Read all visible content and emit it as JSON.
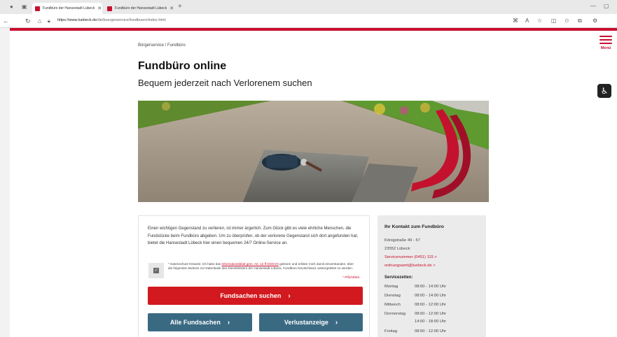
{
  "browser": {
    "tabs": [
      {
        "title": "Fundbüro der Hansestadt Lübeck",
        "active": true
      },
      {
        "title": "Fundbüro der Hansestadt Lübeck",
        "active": false
      }
    ],
    "new_tab": "+",
    "url_host": "https://www.luebeck.de",
    "url_path": "/de/buergerservice/fundbuero/index.html",
    "icons": [
      "profile-icon",
      "tab-actions-icon",
      "back-icon",
      "refresh-icon",
      "home-icon",
      "lock-icon",
      "read-aloud-icon",
      "favorite-icon",
      "split-icon",
      "favorites-icon",
      "collections-icon",
      "extensions-icon"
    ]
  },
  "header": {
    "menu_label": "Menü"
  },
  "breadcrumb": "Bürgerservice / Fundbüro",
  "title": "Fundbüro online",
  "subtitle": "Bequem jederzeit nach Verlorenem suchen",
  "card": {
    "intro": "Einen wichtigen Gegenstand zu verlieren, ist immer ärgerlich. Zum Glück gibt es viele ehrliche Menschen, die Fundstücke beim Fundbüro abgeben. Um zu überprüfen, ob der verlorene Gegenstand sich dort angefunden hat, bietet die Hansestadt Lübeck hier einen bequemen 24/7 Online-Service an.",
    "privacy_before": "* Datenschutz-Hinweis: Ich habe das ",
    "privacy_link": "Informationsblatt gem. Art. 12 ff DSGVO",
    "privacy_after": " gelesen und erkläre mich damit einverstanden, über die folgenden Buttons zur Datenbank des Dienstleisters der Hansestadt Lübeck, Fundbüro Deutschland, weitergeleitet zu werden.",
    "required": "* Pflichtfeld",
    "btn_search": "Fundsachen suchen",
    "btn_all": "Alle Fundsachen",
    "btn_loss": "Verlustanzeige"
  },
  "contact": {
    "heading": "Ihr Kontakt zum Fundbüro",
    "street": "Königstraße 49 - 57",
    "city": "23552 Lübeck",
    "phone": "Servicenummer (0451) 115 >",
    "email": "ordnungsamt@luebeck.de >",
    "hours_heading": "Servicezeiten:",
    "hours": [
      {
        "day": "Montag",
        "time": "08:00 - 14:00 Uhr"
      },
      {
        "day": "Dienstag",
        "time": "08:00 - 14:00 Uhr"
      },
      {
        "day": "Mittwoch",
        "time": "08:00 - 12:00 Uhr"
      },
      {
        "day": "Donnerstag",
        "time": "08:00 - 12:00 Uhr"
      },
      {
        "day": "",
        "time": "14:00 - 18:00 Uhr"
      },
      {
        "day": "Freitag",
        "time": "08:00 - 12:00 Uhr"
      }
    ]
  },
  "colors": {
    "brand_red": "#c8102e",
    "button_blue": "#3a6a82"
  }
}
